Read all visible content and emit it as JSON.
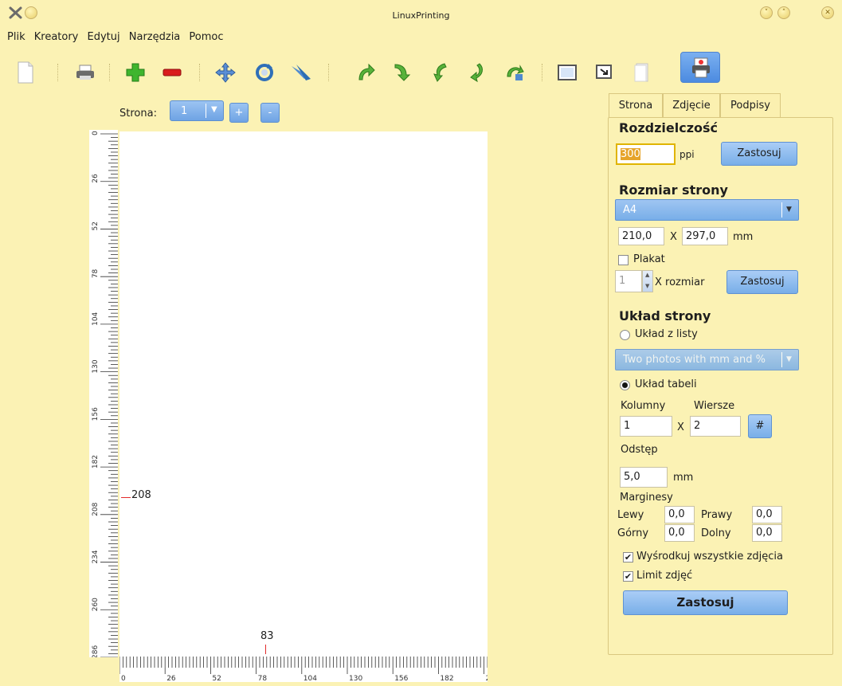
{
  "window": {
    "title": "LinuxPrinting"
  },
  "menu": [
    "Plik",
    "Kreatory",
    "Edytuj",
    "Narzędzia",
    "Pomoc"
  ],
  "page_selector": {
    "label": "Strona:",
    "value": "1",
    "add": "+",
    "remove": "-"
  },
  "canvas": {
    "v_marker": "208",
    "h_marker": "83",
    "v_ruler_labels": [
      "0",
      "26",
      "52",
      "78",
      "104",
      "130",
      "156",
      "182",
      "208",
      "234",
      "260",
      "286"
    ],
    "h_ruler_labels": [
      "0",
      "26",
      "52",
      "78",
      "104",
      "130",
      "156",
      "182",
      "2"
    ]
  },
  "tabs": [
    "Strona",
    "Zdjęcie",
    "Podpisy"
  ],
  "panel": {
    "resolution_title": "Rozdzielczość",
    "resolution_value": "300",
    "resolution_unit": "ppi",
    "apply": "Zastosuj",
    "page_size_title": "Rozmiar strony",
    "page_size_value": "A4",
    "width": "210,0",
    "x": "X",
    "height": "297,0",
    "mm": "mm",
    "poster_label": "Plakat",
    "poster_count": "1",
    "poster_x_size": "X rozmiar",
    "layout_title": "Układ strony",
    "layout_list_label": "Układ z listy",
    "layout_list_value": "Two photos with mm and %",
    "layout_table_label": "Układ tabeli",
    "columns_label": "Kolumny",
    "rows_label": "Wiersze",
    "columns": "1",
    "rows": "2",
    "hash": "#",
    "spacing_label": "Odstęp",
    "spacing": "5,0",
    "margins_label": "Marginesy",
    "left_label": "Lewy",
    "left": "0,0",
    "right_label": "Prawy",
    "right": "0,0",
    "top_label": "Górny",
    "top": "0,0",
    "bottom_label": "Dolny",
    "bottom": "0,0",
    "center_all_label": "Wyśrodkuj wszystkie zdjęcia",
    "limit_label": "Limit zdjęć",
    "final_apply": "Zastosuj"
  }
}
